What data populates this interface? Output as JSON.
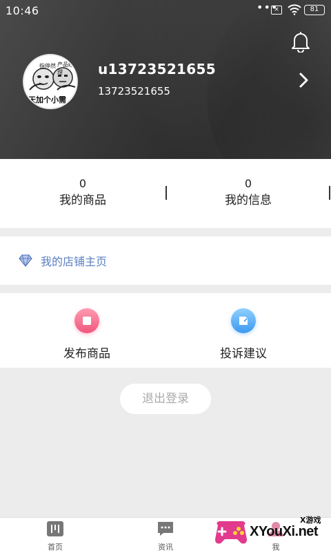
{
  "status_bar": {
    "time": "10:46",
    "more": "•••",
    "sim": "×",
    "battery": "81"
  },
  "profile": {
    "username": "u13723521655",
    "phone": "13723521655",
    "avatar_tags": [
      "指停然",
      "产品经理"
    ],
    "avatar_caption": "天加个小需"
  },
  "stats": [
    {
      "value": "0",
      "label": "我的商品"
    },
    {
      "value": "0",
      "label": "我的信息"
    }
  ],
  "shop_link": {
    "label": "我的店铺主页"
  },
  "actions": [
    {
      "label": "发布商品",
      "color": "#f0577d"
    },
    {
      "label": "投诉建议",
      "color": "#3d98f0"
    }
  ],
  "logout": {
    "label": "退出登录"
  },
  "tabbar": [
    {
      "label": "首页"
    },
    {
      "label": "资讯"
    },
    {
      "label": "我"
    }
  ],
  "watermark": {
    "text": "XYouXi.net",
    "small": "X游戏"
  },
  "colors": {
    "header_bg": "#333333",
    "link_blue": "#5b7ec2",
    "page_bg": "#ececec"
  }
}
